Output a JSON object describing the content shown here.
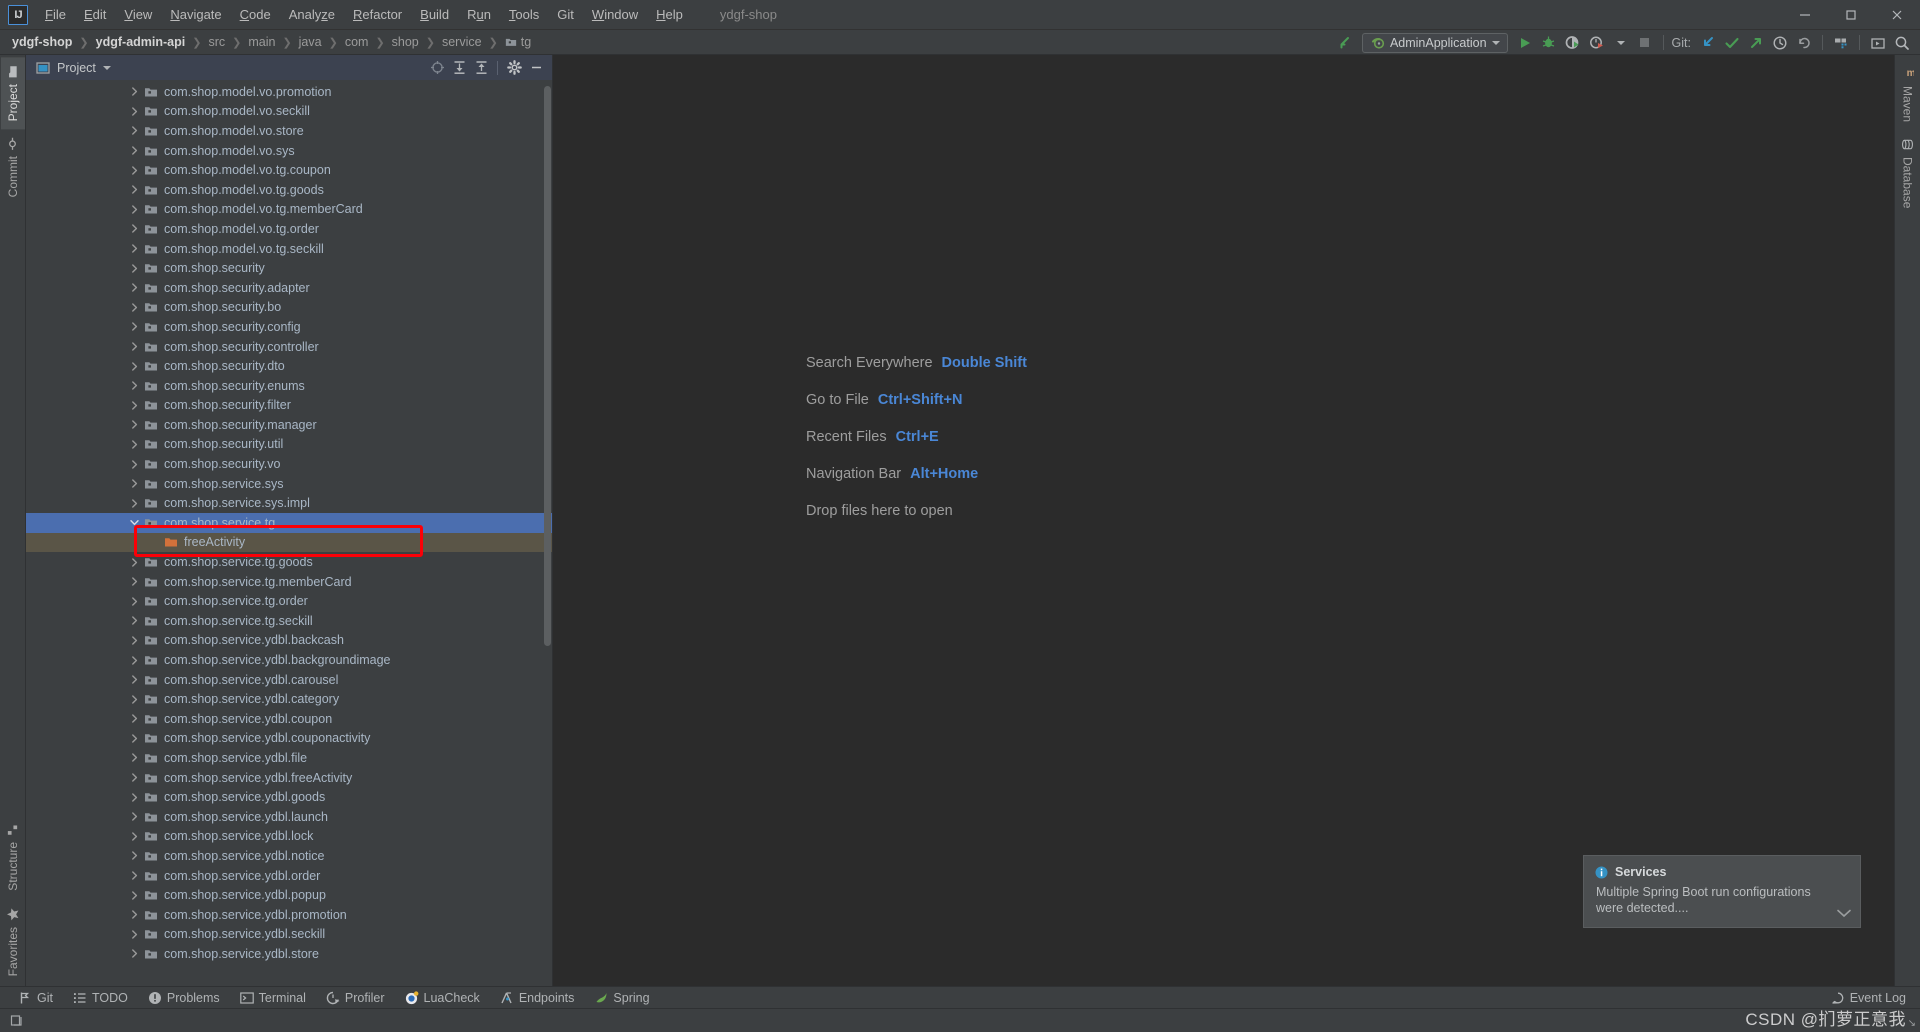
{
  "window": {
    "title": "ydgf-shop",
    "logo": "IJ",
    "controls": [
      {
        "name": "minimize",
        "glyph": "—"
      },
      {
        "name": "maximize",
        "glyph": "☐"
      },
      {
        "name": "close",
        "glyph": "✕"
      }
    ]
  },
  "menubar": [
    {
      "label": "File",
      "mnemonic": "F"
    },
    {
      "label": "Edit",
      "mnemonic": "E"
    },
    {
      "label": "View",
      "mnemonic": "V"
    },
    {
      "label": "Navigate",
      "mnemonic": "N"
    },
    {
      "label": "Code",
      "mnemonic": "C"
    },
    {
      "label": "Analyze",
      "mnemonic": "z"
    },
    {
      "label": "Refactor",
      "mnemonic": "R"
    },
    {
      "label": "Build",
      "mnemonic": "B"
    },
    {
      "label": "Run",
      "mnemonic": "u"
    },
    {
      "label": "Tools",
      "mnemonic": "T"
    },
    {
      "label": "Git",
      "mnemonic": ""
    },
    {
      "label": "Window",
      "mnemonic": "W"
    },
    {
      "label": "Help",
      "mnemonic": "H"
    }
  ],
  "breadcrumb": [
    {
      "label": "ydgf-shop",
      "bold": true,
      "icon": ""
    },
    {
      "label": "ydgf-admin-api",
      "bold": true,
      "icon": ""
    },
    {
      "label": "src",
      "bold": false,
      "icon": ""
    },
    {
      "label": "main",
      "bold": false,
      "icon": ""
    },
    {
      "label": "java",
      "bold": false,
      "icon": ""
    },
    {
      "label": "com",
      "bold": false,
      "icon": ""
    },
    {
      "label": "shop",
      "bold": false,
      "icon": ""
    },
    {
      "label": "service",
      "bold": false,
      "icon": ""
    },
    {
      "label": "tg",
      "bold": false,
      "icon": "folder-icon"
    }
  ],
  "toolbar": {
    "run_config_label": "AdminApplication",
    "git_label": "Git:",
    "icons": [
      "build-icon",
      "run-icon",
      "debug-icon",
      "run-coverage-icon",
      "profiler-icon",
      "stop-icon",
      "update-project-icon",
      "commit-icon",
      "push-icon",
      "history-icon",
      "rollback-icon",
      "search-everywhere-icon"
    ]
  },
  "left_strip": {
    "top": [
      {
        "label": "Project",
        "icon": "project-icon",
        "active": true
      },
      {
        "label": "Commit",
        "icon": "commit-icon",
        "active": false
      }
    ],
    "bottom": [
      {
        "label": "Structure",
        "icon": "structure-icon",
        "active": false
      },
      {
        "label": "Favorites",
        "icon": "star-icon",
        "active": false
      }
    ]
  },
  "right_strip": [
    {
      "label": "Maven",
      "icon": "maven-icon"
    },
    {
      "label": "Database",
      "icon": "database-icon"
    }
  ],
  "project_panel": {
    "title": "Project",
    "header_icons": [
      "select-opened-file-icon",
      "expand-all-icon",
      "collapse-all-icon",
      "settings-gear-icon",
      "hide-icon"
    ],
    "tree": [
      {
        "label": "com.shop.model.vo.promotion",
        "indent": 0,
        "state": "normal"
      },
      {
        "label": "com.shop.model.vo.seckill",
        "indent": 0,
        "state": "normal"
      },
      {
        "label": "com.shop.model.vo.store",
        "indent": 0,
        "state": "normal"
      },
      {
        "label": "com.shop.model.vo.sys",
        "indent": 0,
        "state": "normal"
      },
      {
        "label": "com.shop.model.vo.tg.coupon",
        "indent": 0,
        "state": "normal"
      },
      {
        "label": "com.shop.model.vo.tg.goods",
        "indent": 0,
        "state": "normal"
      },
      {
        "label": "com.shop.model.vo.tg.memberCard",
        "indent": 0,
        "state": "normal"
      },
      {
        "label": "com.shop.model.vo.tg.order",
        "indent": 0,
        "state": "normal"
      },
      {
        "label": "com.shop.model.vo.tg.seckill",
        "indent": 0,
        "state": "normal"
      },
      {
        "label": "com.shop.security",
        "indent": 0,
        "state": "normal"
      },
      {
        "label": "com.shop.security.adapter",
        "indent": 0,
        "state": "normal"
      },
      {
        "label": "com.shop.security.bo",
        "indent": 0,
        "state": "normal"
      },
      {
        "label": "com.shop.security.config",
        "indent": 0,
        "state": "normal"
      },
      {
        "label": "com.shop.security.controller",
        "indent": 0,
        "state": "normal"
      },
      {
        "label": "com.shop.security.dto",
        "indent": 0,
        "state": "normal"
      },
      {
        "label": "com.shop.security.enums",
        "indent": 0,
        "state": "normal"
      },
      {
        "label": "com.shop.security.filter",
        "indent": 0,
        "state": "normal"
      },
      {
        "label": "com.shop.security.manager",
        "indent": 0,
        "state": "normal"
      },
      {
        "label": "com.shop.security.util",
        "indent": 0,
        "state": "normal"
      },
      {
        "label": "com.shop.security.vo",
        "indent": 0,
        "state": "normal"
      },
      {
        "label": "com.shop.service.sys",
        "indent": 0,
        "state": "normal"
      },
      {
        "label": "com.shop.service.sys.impl",
        "indent": 0,
        "state": "normal"
      },
      {
        "label": "com.shop.service.tg",
        "indent": 0,
        "state": "selected",
        "expanded": true
      },
      {
        "label": "freeActivity",
        "indent": 1,
        "state": "selected-dim",
        "leaf": true
      },
      {
        "label": "com.shop.service.tg.goods",
        "indent": 0,
        "state": "normal"
      },
      {
        "label": "com.shop.service.tg.memberCard",
        "indent": 0,
        "state": "normal"
      },
      {
        "label": "com.shop.service.tg.order",
        "indent": 0,
        "state": "normal"
      },
      {
        "label": "com.shop.service.tg.seckill",
        "indent": 0,
        "state": "normal"
      },
      {
        "label": "com.shop.service.ydbl.backcash",
        "indent": 0,
        "state": "normal"
      },
      {
        "label": "com.shop.service.ydbl.backgroundimage",
        "indent": 0,
        "state": "normal"
      },
      {
        "label": "com.shop.service.ydbl.carousel",
        "indent": 0,
        "state": "normal"
      },
      {
        "label": "com.shop.service.ydbl.category",
        "indent": 0,
        "state": "normal"
      },
      {
        "label": "com.shop.service.ydbl.coupon",
        "indent": 0,
        "state": "normal"
      },
      {
        "label": "com.shop.service.ydbl.couponactivity",
        "indent": 0,
        "state": "normal"
      },
      {
        "label": "com.shop.service.ydbl.file",
        "indent": 0,
        "state": "normal"
      },
      {
        "label": "com.shop.service.ydbl.freeActivity",
        "indent": 0,
        "state": "normal"
      },
      {
        "label": "com.shop.service.ydbl.goods",
        "indent": 0,
        "state": "normal"
      },
      {
        "label": "com.shop.service.ydbl.launch",
        "indent": 0,
        "state": "normal"
      },
      {
        "label": "com.shop.service.ydbl.lock",
        "indent": 0,
        "state": "normal"
      },
      {
        "label": "com.shop.service.ydbl.notice",
        "indent": 0,
        "state": "normal"
      },
      {
        "label": "com.shop.service.ydbl.order",
        "indent": 0,
        "state": "normal"
      },
      {
        "label": "com.shop.service.ydbl.popup",
        "indent": 0,
        "state": "normal"
      },
      {
        "label": "com.shop.service.ydbl.promotion",
        "indent": 0,
        "state": "normal"
      },
      {
        "label": "com.shop.service.ydbl.seckill",
        "indent": 0,
        "state": "normal"
      },
      {
        "label": "com.shop.service.ydbl.store",
        "indent": 0,
        "state": "normal"
      }
    ]
  },
  "editor_tips": [
    {
      "label": "Search Everywhere",
      "key": "Double Shift"
    },
    {
      "label": "Go to File",
      "key": "Ctrl+Shift+N"
    },
    {
      "label": "Recent Files",
      "key": "Ctrl+E"
    },
    {
      "label": "Navigation Bar",
      "key": "Alt+Home"
    },
    {
      "label": "Drop files here to open",
      "key": ""
    }
  ],
  "notification": {
    "title": "Services",
    "body": "Multiple Spring Boot run configurations were detected....",
    "icon": "info-icon"
  },
  "toolwindow_bar": {
    "left": [
      {
        "label": "Git",
        "icon": "git-branch-icon"
      },
      {
        "label": "TODO",
        "icon": "todo-icon"
      },
      {
        "label": "Problems",
        "icon": "problems-icon"
      },
      {
        "label": "Terminal",
        "icon": "terminal-icon"
      },
      {
        "label": "Profiler",
        "icon": "profiler-icon"
      },
      {
        "label": "LuaCheck",
        "icon": "luacheck-icon"
      },
      {
        "label": "Endpoints",
        "icon": "endpoints-icon"
      },
      {
        "label": "Spring",
        "icon": "spring-icon"
      }
    ],
    "right": [
      {
        "label": "Event Log",
        "icon": "event-log-icon"
      }
    ]
  },
  "watermark": "CSDN @扪萝正意我",
  "colors": {
    "accent_blue": "#4b6eaf",
    "link_blue": "#4a87d6",
    "annotation_red": "#fb0007",
    "editor_bg": "#2b2b2b",
    "panel_bg": "#3c3f41",
    "folder_orange": "#d2713b"
  }
}
